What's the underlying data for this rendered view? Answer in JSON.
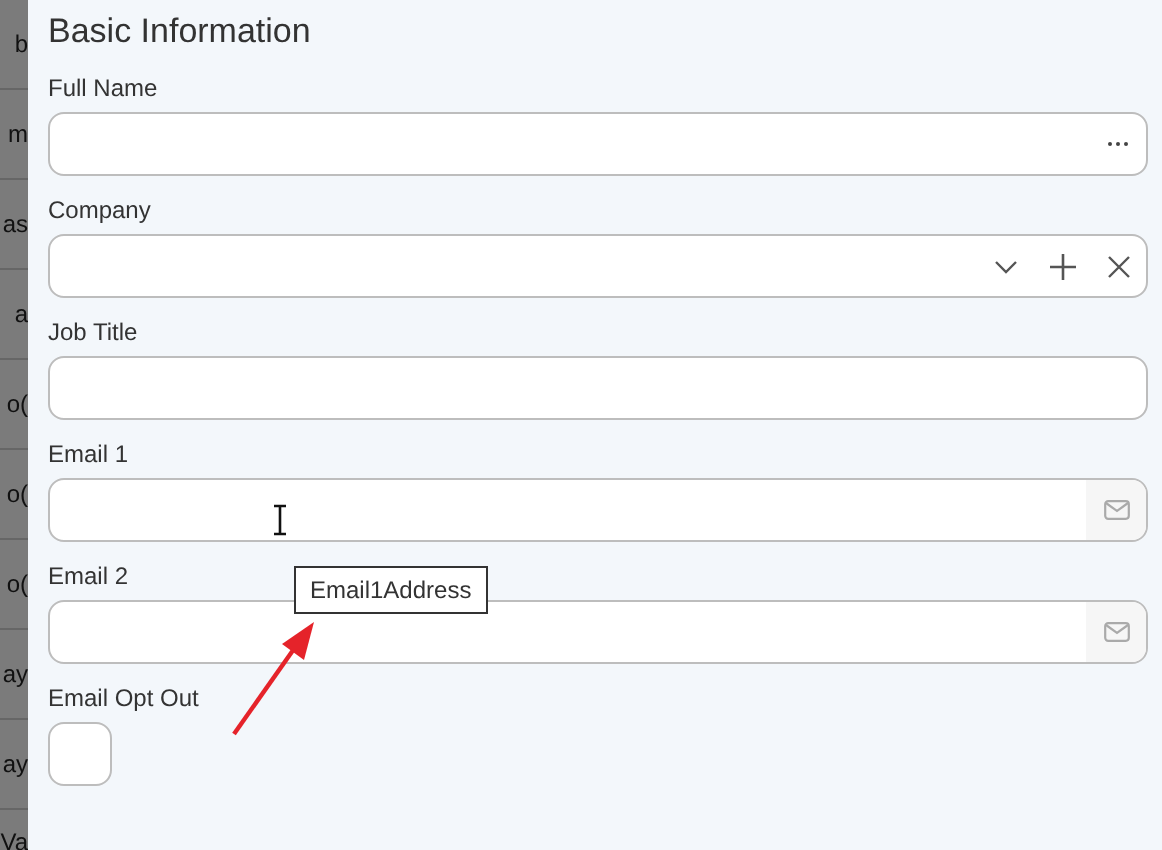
{
  "background_strip": [
    "b",
    "m",
    "as",
    "a",
    "o(",
    "o(",
    "o(",
    "ay",
    "ay",
    "Va"
  ],
  "section": {
    "title": "Basic Information",
    "fields": [
      {
        "label": "Full Name",
        "kind": "ellipsis"
      },
      {
        "label": "Company",
        "kind": "lookup"
      },
      {
        "label": "Job Title",
        "kind": "text"
      },
      {
        "label": "Email 1",
        "kind": "email"
      },
      {
        "label": "Email 2",
        "kind": "email"
      },
      {
        "label": "Email Opt Out",
        "kind": "checkbox",
        "checked": false
      }
    ]
  },
  "tooltip": {
    "text": "Email1Address"
  }
}
